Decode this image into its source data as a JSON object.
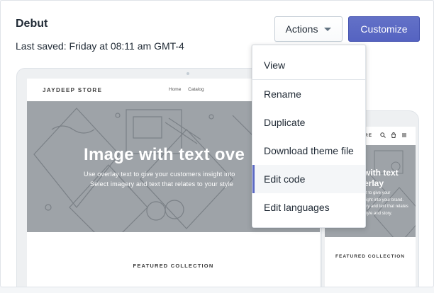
{
  "theme": {
    "title": "Debut",
    "last_saved": "Last saved: Friday at 08:11 am GMT-4"
  },
  "buttons": {
    "actions_label": "Actions",
    "customize_label": "Customize"
  },
  "menu": {
    "items": [
      {
        "label": "View"
      },
      {
        "label": "Rename"
      },
      {
        "label": "Duplicate"
      },
      {
        "label": "Download theme file"
      },
      {
        "label": "Edit code",
        "active": true
      },
      {
        "label": "Edit languages"
      }
    ]
  },
  "preview": {
    "store_name": "JAYDEEP STORE",
    "nav": [
      "Home",
      "Catalog"
    ],
    "hero_title": "Image with text ove",
    "hero_subtitle_line1": "Use overlay text to give your customers insight into",
    "hero_subtitle_line2": "Select imagery and text that relates to your style",
    "featured": "FEATURED COLLECTION"
  },
  "mobile_preview": {
    "store_name": "ORE",
    "hero_title": "with text\nerlay",
    "hero_subtitle": "xt to give your\nsight into your brand.\nery and text that relates\nstyle and story.",
    "featured": "FEATURED COLLECTION"
  },
  "colors": {
    "accent": "#5c6ac4",
    "hero_bg": "#9ea3a8",
    "text": "#212b36"
  }
}
